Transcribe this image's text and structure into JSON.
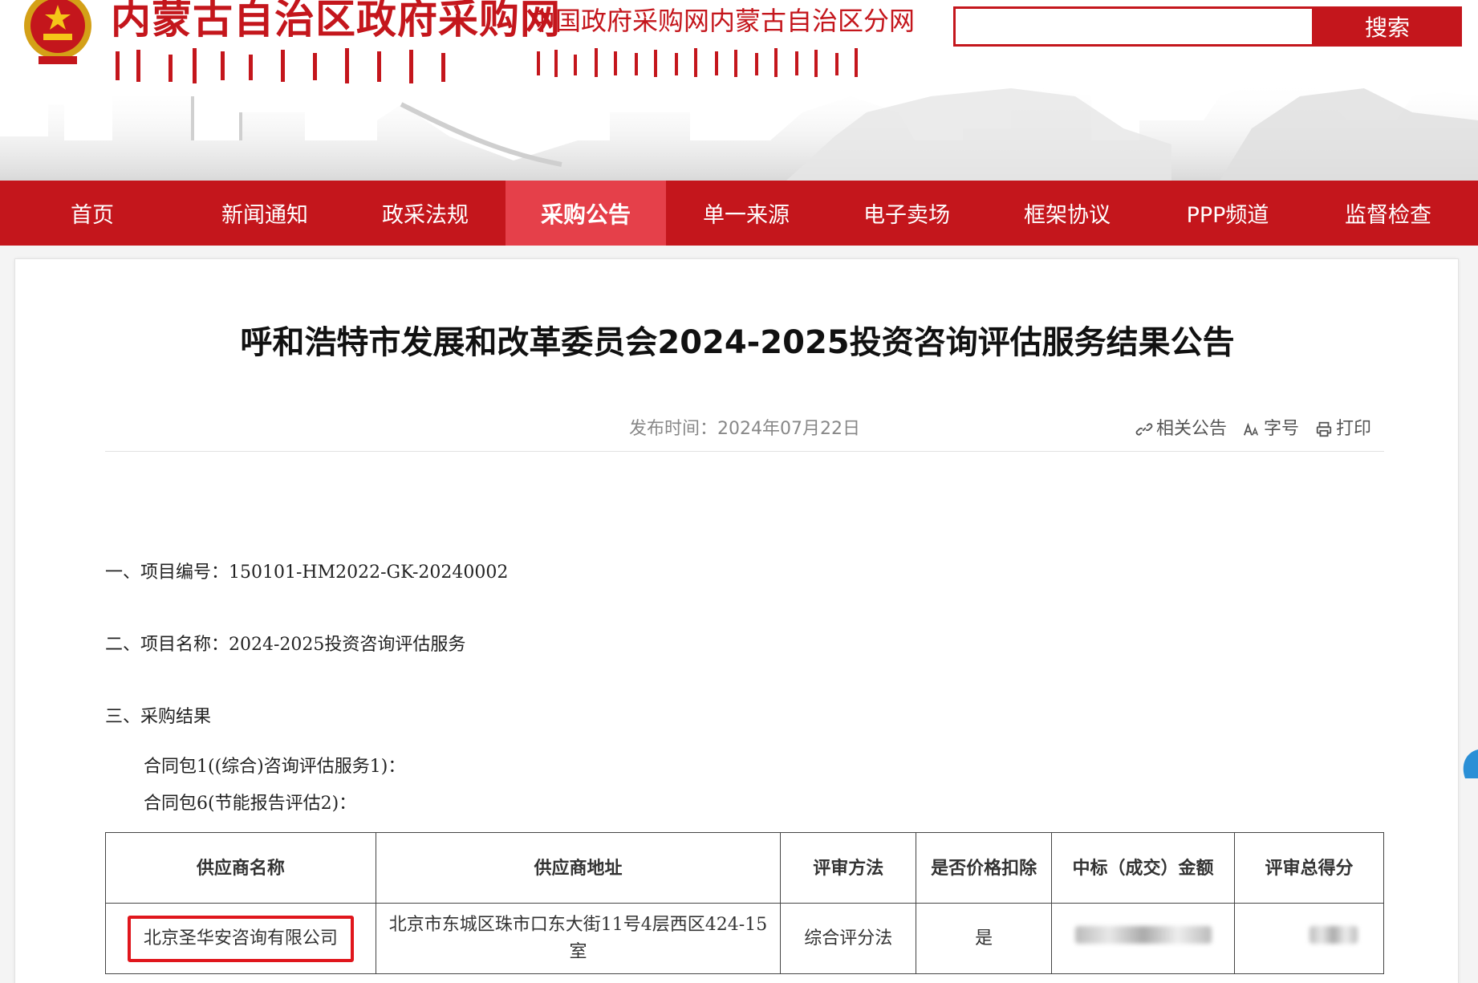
{
  "header": {
    "site_title": "内蒙古自治区政府采购网",
    "site_subtitle": "中国政府采购网内蒙古自治区分网",
    "search_placeholder": "",
    "search_label": "搜索"
  },
  "nav": {
    "items": [
      "首页",
      "新闻通知",
      "政采法规",
      "采购公告",
      "单一来源",
      "电子卖场",
      "框架协议",
      "PPP频道",
      "监督检查"
    ],
    "active": "采购公告"
  },
  "article": {
    "title": "呼和浩特市发展和改革委员会2024-2025投资咨询评估服务结果公告",
    "publish_label": "发布时间：2024年07月22日",
    "tools": {
      "related": "相关公告",
      "font_size": "字号",
      "print": "打印"
    },
    "paragraphs": {
      "project_no": "一、项目编号：150101-HM2022-GK-20240002",
      "project_name": "二、项目名称：2024-2025投资咨询评估服务",
      "result_heading": "三、采购结果",
      "package1": "合同包1((综合)咨询评估服务1)：",
      "package6": "合同包6(节能报告评估2)："
    },
    "table": {
      "headers": [
        "供应商名称",
        "供应商地址",
        "评审方法",
        "是否价格扣除",
        "中标（成交）金额",
        "评审总得分"
      ],
      "rows": [
        {
          "supplier": "北京圣华安咨询有限公司",
          "address": "北京市东城区珠市口东大街11号4层西区424-15室",
          "method": "综合评分法",
          "price_deduction": "是"
        }
      ]
    }
  },
  "colors": {
    "brand_red": "#c4161c",
    "active_nav": "#e5404a",
    "highlight_box": "#e0161c"
  }
}
